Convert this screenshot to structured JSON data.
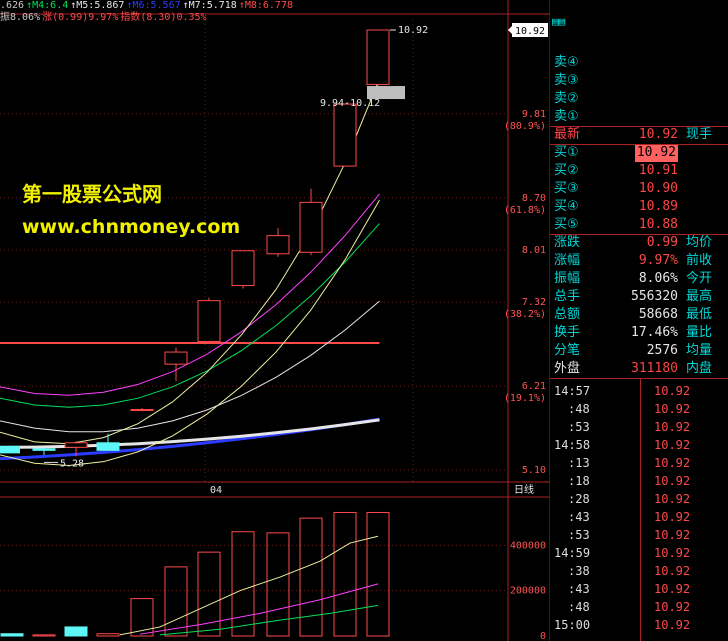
{
  "top_bar": {
    "ma": [
      {
        "label": ".626",
        "color": "#c8c8c8"
      },
      {
        "label": "↑M4:6.4",
        "color": "#00e05a"
      },
      {
        "label": "↑M5:5.867",
        "color": "#e6e6e6"
      },
      {
        "label": "↑M6:5.567",
        "color": "#2b3bff"
      },
      {
        "label": "↑M7:5.718",
        "color": "#e6e6e6"
      },
      {
        "label": "↑M8:6.778",
        "color": "#ff4a4a"
      }
    ],
    "line2": [
      {
        "label": "振8.06%",
        "color": "#c8c8c8"
      },
      {
        "label": "涨(0.99)9.97%",
        "color": "#ff4a4a"
      },
      {
        "label": "指数(8.30)0.35%",
        "color": "#ff4a4a"
      }
    ]
  },
  "watermark": {
    "line1": "第一股票公式网",
    "line2": "www.chnmoney.com"
  },
  "price_axis": {
    "current_tag": "10.92",
    "ticks": [
      {
        "price": "9.81",
        "pct": "(80.9%)"
      },
      {
        "price": "8.70",
        "pct": "(61.8%)"
      },
      {
        "price": "8.01",
        "pct": ""
      },
      {
        "price": "7.32",
        "pct": "(38.2%)"
      },
      {
        "price": "6.21",
        "pct": "(19.1%)"
      },
      {
        "price": "5.10",
        "pct": ""
      }
    ]
  },
  "annotations": {
    "high_label": "10.92",
    "range_label": "9.94-10.12",
    "low_label": "5.28",
    "date_label": "04",
    "period_label": "日线"
  },
  "volume_axis": {
    "ticks": [
      "400000",
      "200000",
      "0"
    ]
  },
  "chart_data": {
    "type": "candlestick",
    "title": "",
    "ylim": [
      5.1,
      10.92
    ],
    "candles": [
      {
        "open": 5.38,
        "high": 5.4,
        "low": 5.3,
        "close": 5.36,
        "color": "cyan"
      },
      {
        "open": 5.4,
        "high": 5.48,
        "low": 5.28,
        "close": 5.46,
        "color": "red"
      },
      {
        "open": 5.46,
        "high": 5.58,
        "low": 5.4,
        "close": 5.36,
        "color": "cyan"
      },
      {
        "open": 5.9,
        "high": 5.92,
        "low": 5.88,
        "close": 5.9,
        "color": "red"
      },
      {
        "open": 6.5,
        "high": 6.72,
        "low": 6.28,
        "close": 6.66,
        "color": "red"
      },
      {
        "open": 6.8,
        "high": 7.38,
        "low": 6.8,
        "close": 7.34,
        "color": "red"
      },
      {
        "open": 7.54,
        "high": 8.0,
        "low": 7.5,
        "close": 8.0,
        "color": "red"
      },
      {
        "open": 7.96,
        "high": 8.3,
        "low": 7.92,
        "close": 8.2,
        "color": "red"
      },
      {
        "open": 7.98,
        "high": 8.82,
        "low": 7.94,
        "close": 8.64,
        "color": "red"
      },
      {
        "open": 9.12,
        "high": 9.95,
        "low": 9.12,
        "close": 9.94,
        "color": "red"
      },
      {
        "open": 10.2,
        "high": 10.92,
        "low": 10.02,
        "close": 10.92,
        "color": "red"
      }
    ],
    "volumes": [
      0,
      10000,
      5000,
      40000,
      10000,
      165000,
      305000,
      370000,
      460000,
      455000,
      520000,
      545000,
      545000
    ],
    "ma_lines": [
      {
        "name": "M4",
        "color": "#00e05a"
      },
      {
        "name": "M5",
        "color": "#e6e6e6"
      },
      {
        "name": "M6",
        "color": "#2b3bff"
      },
      {
        "name": "M8",
        "color": "#ff4a4a"
      }
    ]
  },
  "quote_panel": {
    "order_book": [
      {
        "label": "卖④",
        "price": "",
        "vol": ""
      },
      {
        "label": "卖③",
        "price": "",
        "vol": ""
      },
      {
        "label": "卖②",
        "price": "",
        "vol": ""
      },
      {
        "label": "卖①",
        "price": "",
        "vol": ""
      }
    ],
    "latest": {
      "label": "最新",
      "price": "10.92",
      "tag": "现手"
    },
    "bids": [
      {
        "label": "买①",
        "price": "10.92"
      },
      {
        "label": "买②",
        "price": "10.91"
      },
      {
        "label": "买③",
        "price": "10.90"
      },
      {
        "label": "买④",
        "price": "10.89"
      },
      {
        "label": "买⑤",
        "price": "10.88"
      }
    ],
    "stats": [
      {
        "label": "涨跌",
        "value": "0.99",
        "label2": "均价",
        "vcolor": "#ff4a4a"
      },
      {
        "label": "涨幅",
        "value": "9.97%",
        "label2": "前收",
        "vcolor": "#ff4a4a"
      },
      {
        "label": "振幅",
        "value": "8.06%",
        "label2": "今开",
        "vcolor": "#e6e6e6"
      },
      {
        "label": "总手",
        "value": "556320",
        "label2": "最高",
        "vcolor": "#e6e6e6"
      },
      {
        "label": "总额",
        "value": "58668",
        "label2": "最低",
        "vcolor": "#e6e6e6"
      },
      {
        "label": "换手",
        "value": "17.46%",
        "label2": "量比",
        "vcolor": "#e6e6e6"
      },
      {
        "label": "分笔",
        "value": "2576",
        "label2": "均量",
        "vcolor": "#e6e6e6"
      }
    ],
    "outer": {
      "label": "外盘",
      "value": "311180",
      "label2": "内盘"
    },
    "ticks": [
      {
        "time": "14:57",
        "price": "10.92"
      },
      {
        "time": ":48",
        "price": "10.92"
      },
      {
        "time": ":53",
        "price": "10.92"
      },
      {
        "time": "14:58",
        "price": "10.92"
      },
      {
        "time": ":13",
        "price": "10.92"
      },
      {
        "time": ":18",
        "price": "10.92"
      },
      {
        "time": ":28",
        "price": "10.92"
      },
      {
        "time": ":43",
        "price": "10.92"
      },
      {
        "time": ":53",
        "price": "10.92"
      },
      {
        "time": "14:59",
        "price": "10.92"
      },
      {
        "time": ":38",
        "price": "10.92"
      },
      {
        "time": ":43",
        "price": "10.92"
      },
      {
        "time": ":48",
        "price": "10.92"
      },
      {
        "time": "15:00",
        "price": "10.92"
      }
    ]
  }
}
